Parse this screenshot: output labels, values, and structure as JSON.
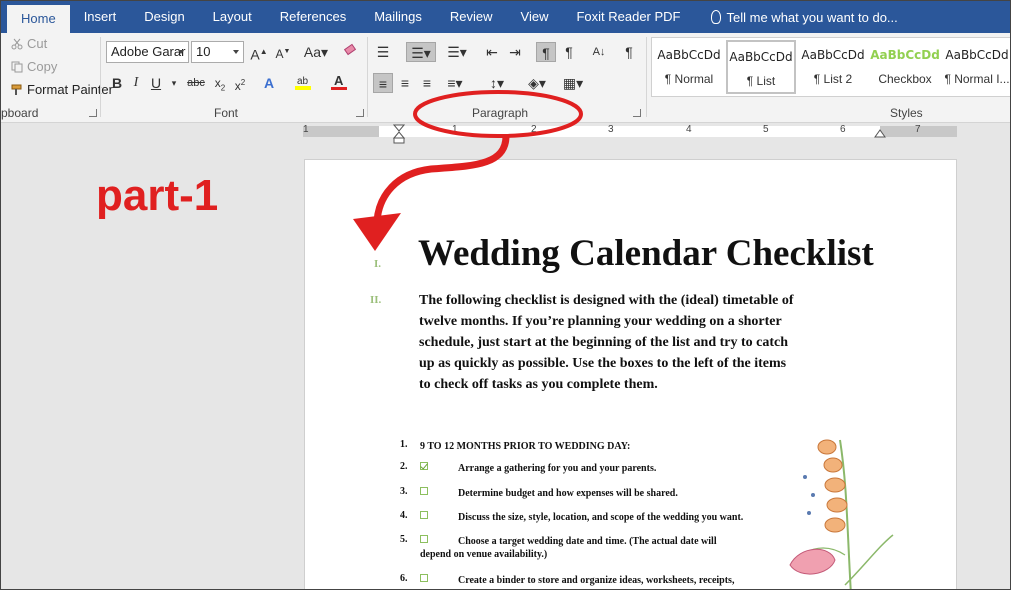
{
  "tabs": [
    {
      "label": "Home",
      "active": true
    },
    {
      "label": "Insert"
    },
    {
      "label": "Design"
    },
    {
      "label": "Layout"
    },
    {
      "label": "References"
    },
    {
      "label": "Mailings"
    },
    {
      "label": "Review"
    },
    {
      "label": "View"
    },
    {
      "label": "Foxit Reader PDF"
    }
  ],
  "tell_me": "Tell me what you want to do...",
  "clipboard": {
    "cut": "Cut",
    "copy": "Copy",
    "format_painter": "Format Painter",
    "label": "pboard"
  },
  "font": {
    "family": "Adobe Garar",
    "size": "10",
    "label": "Font"
  },
  "paragraph": {
    "label": "Paragraph"
  },
  "styles": {
    "label": "Styles",
    "sample": "AaBbCcDd",
    "items": [
      {
        "name": "¶ Normal"
      },
      {
        "name": "¶ List",
        "active": true
      },
      {
        "name": "¶ List 2"
      },
      {
        "name": "Checkbox",
        "color": "#92d050"
      },
      {
        "name": "¶ Normal I..."
      }
    ]
  },
  "ruler_numbers": [
    "1",
    "1",
    "2",
    "3",
    "4",
    "5",
    "6",
    "7"
  ],
  "annotation": {
    "text": "part-1",
    "color": "#e02020"
  },
  "document": {
    "roman_1": "I.",
    "roman_2": "II.",
    "title": "Wedding Calendar Checklist",
    "intro": "The following checklist is designed with the (ideal) timetable of twelve months. If you’re planning your wedding on a shorter schedule, just start at the beginning of the list and try to catch up as quickly as possible. Use the boxes to the left of the items to check off tasks as you complete them.",
    "items": [
      {
        "num": "1.",
        "text": "9 TO 12 MONTHS PRIOR TO WEDDING DAY:",
        "heading": true
      },
      {
        "num": "2.",
        "text": "Arrange a gathering for you and your parents.",
        "checked": true
      },
      {
        "num": "3.",
        "text": "Determine budget and how expenses will be shared."
      },
      {
        "num": "4.",
        "text": "Discuss the size, style, location, and scope of the wedding you want."
      },
      {
        "num": "5.",
        "text": "Choose a target wedding date and time. (The actual date will",
        "cont": "depend on venue availability.)"
      },
      {
        "num": "6.",
        "text": "Create a binder to store and organize ideas, worksheets, receipts,"
      }
    ]
  }
}
